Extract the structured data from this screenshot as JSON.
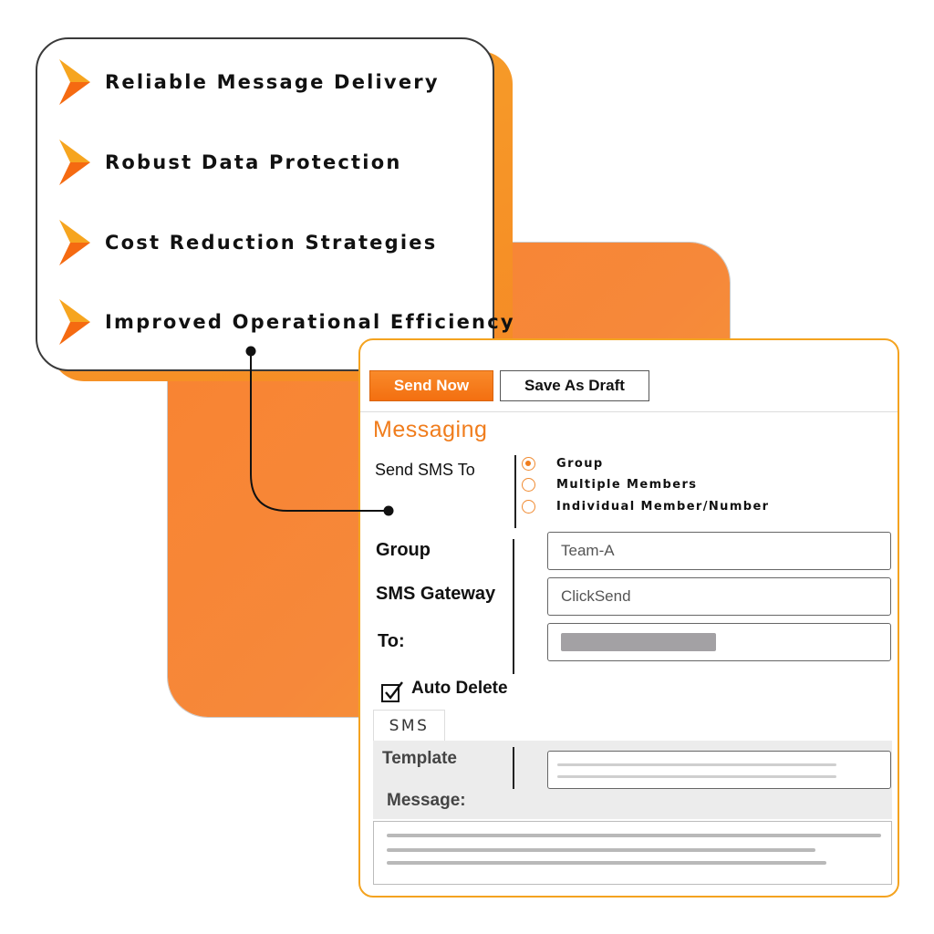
{
  "features": {
    "items": [
      {
        "label": "Reliable Message Delivery"
      },
      {
        "label": "Robust Data Protection"
      },
      {
        "label": "Cost Reduction Strategies"
      },
      {
        "label": "Improved Operational Efficiency"
      }
    ],
    "icon": "chevron-right-icon"
  },
  "colors": {
    "accent": "#f07d1d",
    "button": "#f36f10",
    "panel_border": "#f4a320",
    "backdrop": "#f98330"
  },
  "toolbar": {
    "send_now_label": "Send Now",
    "save_draft_label": "Save As Draft"
  },
  "messaging": {
    "title": "Messaging",
    "send_sms_to_label": "Send SMS To",
    "recipient_options": [
      {
        "label": "Group",
        "selected": true
      },
      {
        "label": "Multiple Members",
        "selected": false
      },
      {
        "label": "Individual Member/Number",
        "selected": false
      }
    ],
    "group_label": "Group",
    "group_value": "Team-A",
    "gateway_label": "SMS Gateway",
    "gateway_value": "ClickSend",
    "to_label": "To:",
    "auto_delete_label": "Auto Delete",
    "auto_delete_checked": true,
    "tab_label": "SMS",
    "template_label": "Template",
    "message_label": "Message:"
  }
}
